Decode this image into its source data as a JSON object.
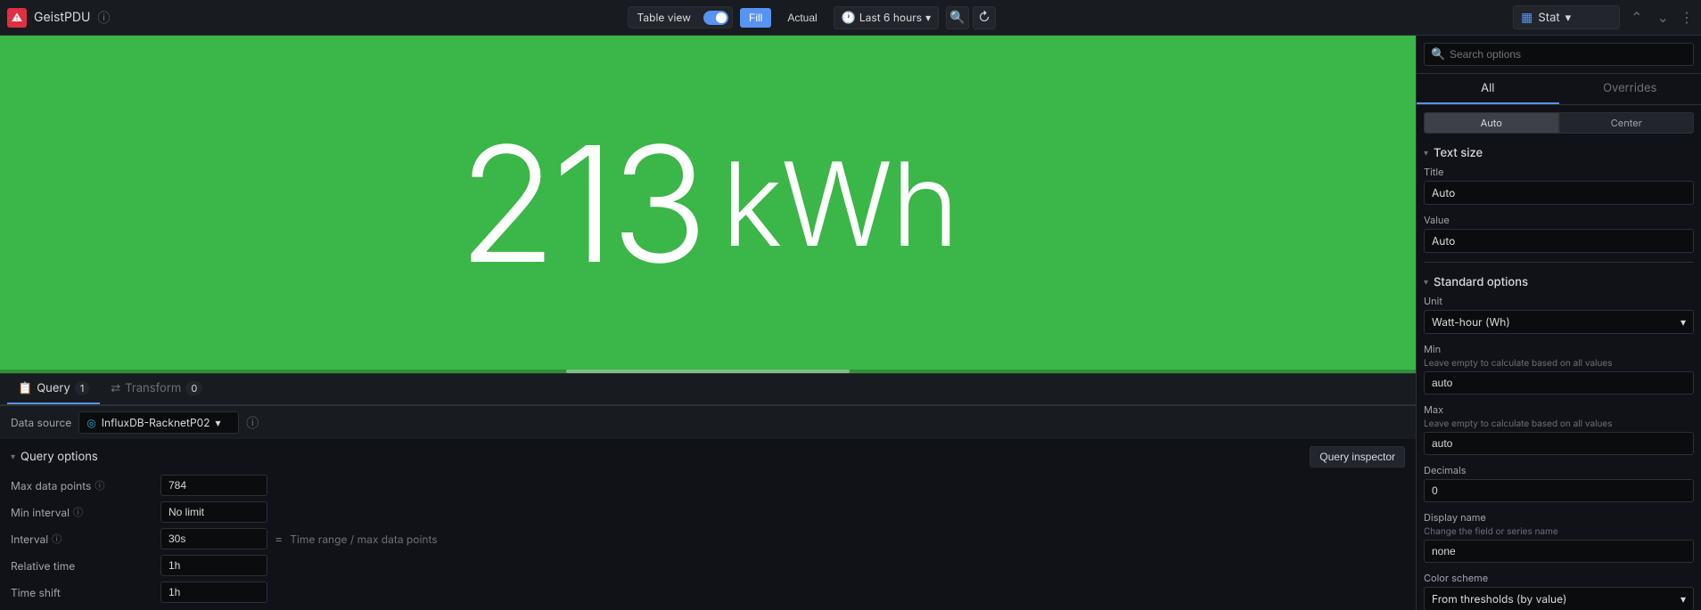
{
  "toolbar": {
    "panel_title": "GeistPDU",
    "table_view_label": "Table view",
    "fill_label": "Fill",
    "actual_label": "Actual",
    "time_range_label": "Last 6 hours",
    "stat_label": "Stat",
    "three_dots": "⋮"
  },
  "right_panel": {
    "search_placeholder": "Search options",
    "all_tab": "All",
    "overrides_tab": "Overrides"
  },
  "text_size": {
    "section_title": "Text size",
    "title_label": "Title",
    "title_value": "Auto",
    "value_label": "Value",
    "value_value": "Auto"
  },
  "standard_options": {
    "section_title": "Standard options",
    "unit_label": "Unit",
    "unit_value": "Watt-hour (Wh)",
    "min_label": "Min",
    "min_hint": "Leave empty to calculate based on all values",
    "min_value": "auto",
    "max_label": "Max",
    "max_hint": "Leave empty to calculate based on all values",
    "max_value": "auto",
    "decimals_label": "Decimals",
    "decimals_value": "0",
    "display_name_label": "Display name",
    "display_name_hint": "Change the field or series name",
    "display_name_value": "none",
    "color_scheme_label": "Color scheme",
    "color_scheme_value": "From thresholds (by value)"
  },
  "visualization": {
    "value": "213",
    "unit": "kWh"
  },
  "tabs": {
    "query_label": "Query",
    "query_count": "1",
    "transform_label": "Transform",
    "transform_count": "0"
  },
  "data_source": {
    "label": "Data source",
    "value": "InfluxDB-RacknetP02"
  },
  "query_options": {
    "title": "Query options",
    "inspector_label": "Query inspector",
    "max_data_points_label": "Max data points",
    "max_data_points_value": "784",
    "min_interval_label": "Min interval",
    "min_interval_value": "No limit",
    "interval_label": "Interval",
    "interval_value": "30s",
    "interval_equal": "=",
    "interval_hint": "Time range / max data points",
    "relative_time_label": "Relative time",
    "relative_time_value": "1h",
    "time_shift_label": "Time shift",
    "time_shift_value": "1h"
  },
  "auto_buttons": {
    "auto": "Auto",
    "center": "Center"
  }
}
